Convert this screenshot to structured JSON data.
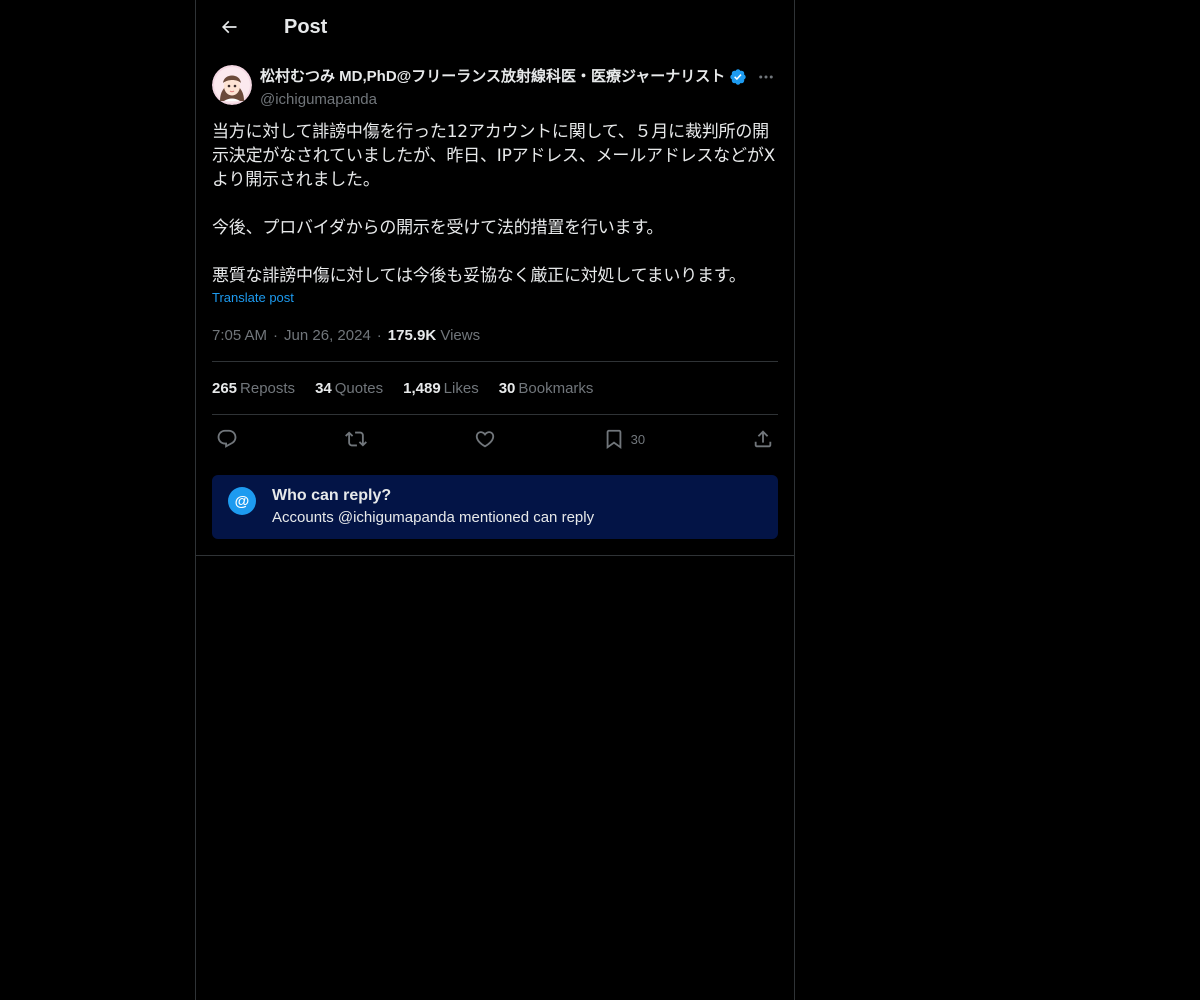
{
  "header": {
    "title": "Post",
    "back_icon": "arrow-left-icon"
  },
  "author": {
    "display_name": "松村むつみ MD,PhD@フリーランス放射線科医・医療ジャーナリスト",
    "handle": "@ichigumapanda",
    "verified": true,
    "verified_color": "#1d9bf0"
  },
  "post": {
    "text": "当方に対して誹謗中傷を行った12アカウントに関して、５月に裁判所の開示決定がなされていましたが、昨日、IPアドレス、メールアドレスなどがXより開示されました。\n\n今後、プロバイダからの開示を受けて法的措置を行います。\n\n悪質な誹謗中傷に対しては今後も妥協なく厳正に対処してまいります。",
    "translate_label": "Translate post",
    "time": "7:05 AM",
    "date": "Jun 26, 2024",
    "views_count": "175.9K",
    "views_label": "Views",
    "separator": "·"
  },
  "stats": {
    "reposts": {
      "count": "265",
      "label": "Reposts"
    },
    "quotes": {
      "count": "34",
      "label": "Quotes"
    },
    "likes": {
      "count": "1,489",
      "label": "Likes"
    },
    "bookmarks": {
      "count": "30",
      "label": "Bookmarks"
    }
  },
  "actions": {
    "reply_icon": "reply-icon",
    "repost_icon": "repost-icon",
    "like_icon": "heart-icon",
    "bookmark_icon": "bookmark-icon",
    "bookmark_count": "30",
    "share_icon": "share-icon"
  },
  "reply_restriction": {
    "icon": "@",
    "title": "Who can reply?",
    "subtitle": "Accounts @ichigumapanda mentioned can reply",
    "background": "#031446"
  }
}
